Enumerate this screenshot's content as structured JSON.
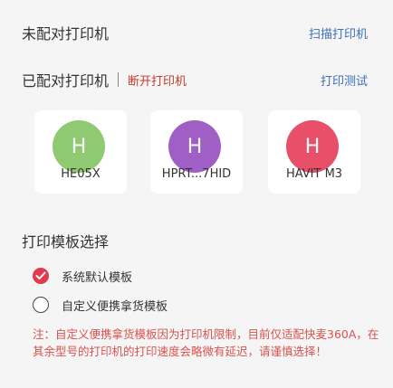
{
  "unpaired": {
    "title": "未配对打印机",
    "scan_label": "扫描打印机"
  },
  "paired": {
    "title": "已配对打印机",
    "disconnect_label": "断开打印机",
    "test_label": "打印测试"
  },
  "printers": [
    {
      "initial": "H",
      "name": "HE05X",
      "color": "#8fca72"
    },
    {
      "initial": "H",
      "name": "HPRT...7HID",
      "color": "#a05fc5"
    },
    {
      "initial": "H",
      "name": "HAVIT M3",
      "color": "#e84f68"
    }
  ],
  "template": {
    "title": "打印模板选择",
    "options": [
      {
        "label": "系统默认模板",
        "selected": true
      },
      {
        "label": "自定义便携拿货模板",
        "selected": false
      }
    ],
    "note": "注：自定义便携拿货模板因为打印机限制，目前仅适配快麦360A，在其余型号的打印机的打印速度会略微有延迟，请谨慎选择！"
  },
  "colors": {
    "accent": "#e03a4c",
    "link": "#3b6fb7",
    "warning": "#d9534f"
  }
}
